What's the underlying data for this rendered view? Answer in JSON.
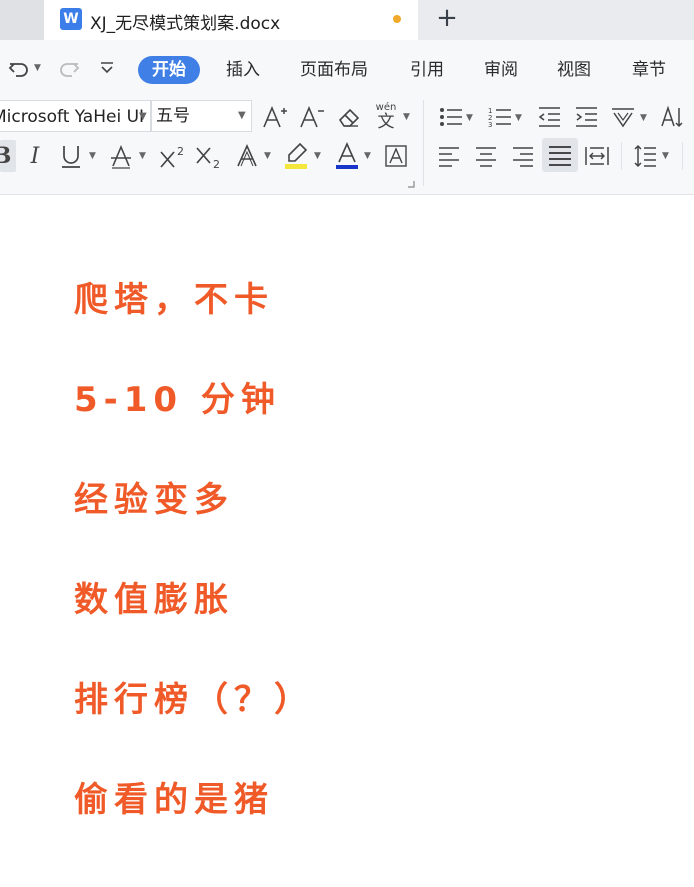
{
  "window": {
    "tab_title": "XJ_无尽模式策划案.docx",
    "new_tab": "+",
    "unsaved_color": "#f0a92b",
    "doc_icon_glyph": "W"
  },
  "menu": {
    "items": [
      {
        "label": "开始",
        "active": true
      },
      {
        "label": "插入"
      },
      {
        "label": "页面布局"
      },
      {
        "label": "引用"
      },
      {
        "label": "审阅"
      },
      {
        "label": "视图"
      },
      {
        "label": "章节"
      }
    ],
    "accent_color": "#3f7fe6"
  },
  "ribbon": {
    "font_name": "Microsoft YaHei UI",
    "font_size": "五号",
    "phonetic": "wén",
    "phonetic_char": "文"
  },
  "document": {
    "text_color": "#f05a28",
    "lines": [
      "爬塔，不卡",
      "5-10 分钟",
      "经验变多",
      "数值膨胀",
      "排行榜（？）",
      "偷看的是猪"
    ]
  }
}
